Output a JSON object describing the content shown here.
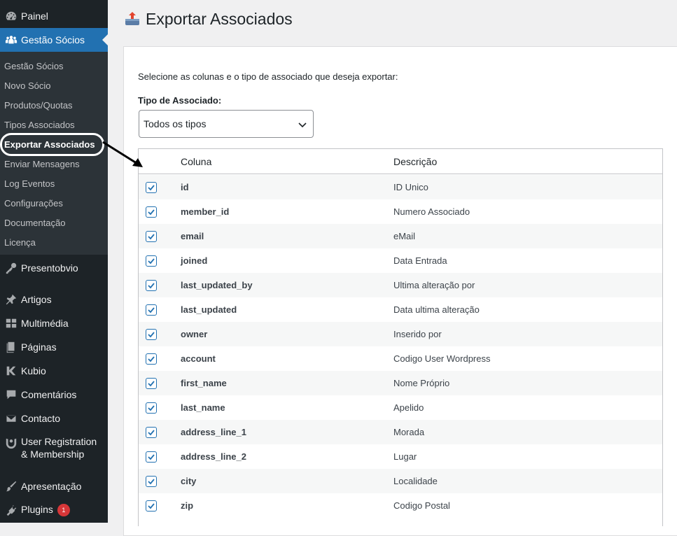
{
  "sidebar": {
    "top_item": {
      "label": "Painel",
      "icon": "dashboard-icon"
    },
    "current": {
      "label": "Gestão Sócios",
      "icon": "groups-icon"
    },
    "submenu": [
      {
        "label": "Gestão Sócios"
      },
      {
        "label": "Novo Sócio"
      },
      {
        "label": "Produtos/Quotas"
      },
      {
        "label": "Tipos Associados"
      },
      {
        "label": "Exportar Associados"
      },
      {
        "label": "Enviar Mensagens"
      },
      {
        "label": "Log Eventos"
      },
      {
        "label": "Configurações"
      },
      {
        "label": "Documentação"
      },
      {
        "label": "Licença"
      }
    ],
    "items": [
      {
        "label": "Presentobvio",
        "icon": "key-icon"
      },
      {
        "label": "Artigos",
        "icon": "pin-icon"
      },
      {
        "label": "Multimédia",
        "icon": "media-icon"
      },
      {
        "label": "Páginas",
        "icon": "pages-icon"
      },
      {
        "label": "Kubio",
        "icon": "kubio-icon"
      },
      {
        "label": "Comentários",
        "icon": "comments-icon"
      },
      {
        "label": "Contacto",
        "icon": "mail-icon"
      },
      {
        "label_line1": "User Registration",
        "label_line2": "& Membership",
        "icon": "user-registration-icon"
      },
      {
        "label": "Apresentação",
        "icon": "brush-icon"
      },
      {
        "label": "Plugins",
        "icon": "plugins-icon",
        "badge": "1"
      }
    ]
  },
  "page": {
    "title": "Exportar Associados",
    "intro": "Selecione as colunas e o tipo de associado que deseja exportar:",
    "type_label": "Tipo de Associado:",
    "type_select_value": "Todos os tipos"
  },
  "table": {
    "headers": {
      "column": "Coluna",
      "description": "Descrição"
    },
    "rows": [
      {
        "column": "id",
        "description": "ID Unico",
        "checked": true
      },
      {
        "column": "member_id",
        "description": "Numero Associado",
        "checked": true
      },
      {
        "column": "email",
        "description": "eMail",
        "checked": true
      },
      {
        "column": "joined",
        "description": "Data Entrada",
        "checked": true
      },
      {
        "column": "last_updated_by",
        "description": "Ultima alteração por",
        "checked": true
      },
      {
        "column": "last_updated",
        "description": "Data ultima alteração",
        "checked": true
      },
      {
        "column": "owner",
        "description": "Inserido por",
        "checked": true
      },
      {
        "column": "account",
        "description": "Codigo User Wordpress",
        "checked": true
      },
      {
        "column": "first_name",
        "description": "Nome Próprio",
        "checked": true
      },
      {
        "column": "last_name",
        "description": "Apelido",
        "checked": true
      },
      {
        "column": "address_line_1",
        "description": "Morada",
        "checked": true
      },
      {
        "column": "address_line_2",
        "description": "Lugar",
        "checked": true
      },
      {
        "column": "city",
        "description": "Localidade",
        "checked": true
      },
      {
        "column": "zip",
        "description": "Codigo Postal",
        "checked": true
      }
    ]
  },
  "colors": {
    "accent": "#2271b1",
    "sidebar_bg": "#1d2327",
    "submenu_bg": "#2c3338",
    "badge": "#d63638"
  }
}
